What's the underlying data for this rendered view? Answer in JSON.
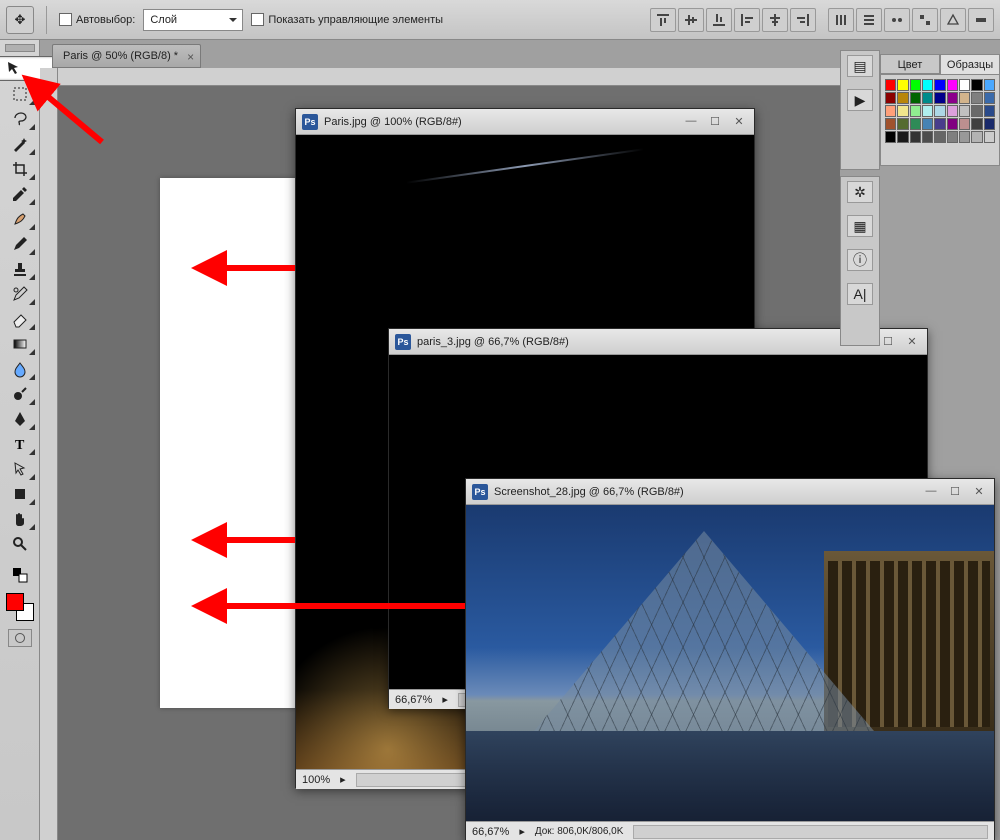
{
  "options_bar": {
    "auto_select_label": "Автовыбор:",
    "auto_select_value": "Слой",
    "show_controls_label": "Показать управляющие элементы"
  },
  "document_tab": {
    "title": "Paris @ 50% (RGB/8) *"
  },
  "tools": [
    "move",
    "marquee",
    "lasso",
    "wand",
    "crop",
    "eyedropper",
    "healing",
    "brush",
    "stamp",
    "history-brush",
    "eraser",
    "gradient",
    "blur",
    "dodge",
    "pen",
    "type",
    "path-select",
    "rectangle",
    "hand",
    "zoom"
  ],
  "foreground_color": "#ff0000",
  "background_color": "#ffffff",
  "panel_tabs": {
    "color": "Цвет",
    "swatches": "Образцы"
  },
  "swatch_colors": [
    "#ff0000",
    "#ffff00",
    "#00ff00",
    "#00ffff",
    "#0000ff",
    "#ff00ff",
    "#ffffff",
    "#000000",
    "#4aa8ff",
    "#8b0000",
    "#b8860b",
    "#006400",
    "#008b8b",
    "#00008b",
    "#8b008b",
    "#d2b48c",
    "#808080",
    "#3a6aaa",
    "#ffa07a",
    "#f0e68c",
    "#90ee90",
    "#afeeee",
    "#add8e6",
    "#dda0dd",
    "#c0c0c0",
    "#696969",
    "#2a4a8a",
    "#a0522d",
    "#556b2f",
    "#2e8b57",
    "#4682b4",
    "#483d8b",
    "#800080",
    "#bc8f8f",
    "#404040",
    "#1a2a6a",
    "#000000",
    "#1a1a1a",
    "#333333",
    "#4d4d4d",
    "#666666",
    "#808080",
    "#999999",
    "#b3b3b3",
    "#cccccc"
  ],
  "dock_icons": [
    "layers",
    "arrow",
    "navigator",
    "styles",
    "info",
    "",
    "type"
  ],
  "windows": [
    {
      "title": "Paris.jpg @ 100% (RGB/8#)",
      "zoom": "100%",
      "status": ""
    },
    {
      "title": "paris_3.jpg @ 66,7% (RGB/8#)",
      "zoom": "66,67%",
      "status": ""
    },
    {
      "title": "Screenshot_28.jpg @ 66,7% (RGB/8#)",
      "zoom": "66,67%",
      "status": "Док: 806,0K/806,0K"
    }
  ]
}
